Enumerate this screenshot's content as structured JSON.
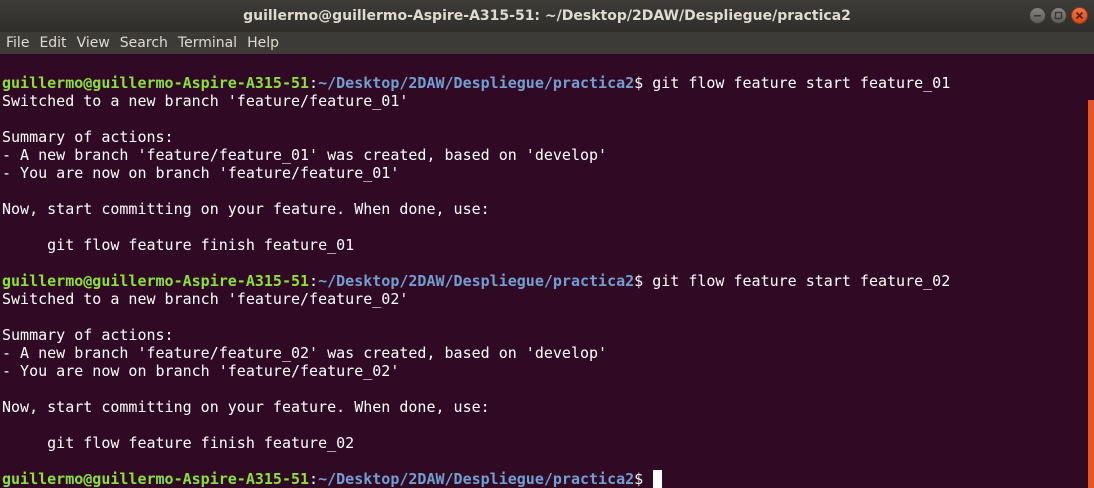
{
  "window": {
    "title": "guillermo@guillermo-Aspire-A315-51: ~/Desktop/2DAW/Despliegue/practica2"
  },
  "menu": {
    "items": [
      "File",
      "Edit",
      "View",
      "Search",
      "Terminal",
      "Help"
    ]
  },
  "colors": {
    "background": "#300a24",
    "prompt_user": "#8ae234",
    "prompt_path": "#729fcf",
    "text": "#ffffff",
    "scrollbar": "#e95420"
  },
  "terminal": {
    "prompts": [
      {
        "user": "guillermo@guillermo-Aspire-A315-51",
        "sep": ":",
        "path": "~/Desktop/2DAW/Despliegue/practica2",
        "symbol": "$ ",
        "command": "git flow feature start feature_01"
      },
      {
        "user": "guillermo@guillermo-Aspire-A315-51",
        "sep": ":",
        "path": "~/Desktop/2DAW/Despliegue/practica2",
        "symbol": "$ ",
        "command": "git flow feature start feature_02"
      },
      {
        "user": "guillermo@guillermo-Aspire-A315-51",
        "sep": ":",
        "path": "~/Desktop/2DAW/Despliegue/practica2",
        "symbol": "$ ",
        "command": ""
      }
    ],
    "outputs": [
      [
        "Switched to a new branch 'feature/feature_01'",
        "",
        "Summary of actions:",
        "- A new branch 'feature/feature_01' was created, based on 'develop'",
        "- You are now on branch 'feature/feature_01'",
        "",
        "Now, start committing on your feature. When done, use:",
        "",
        "     git flow feature finish feature_01",
        ""
      ],
      [
        "Switched to a new branch 'feature/feature_02'",
        "",
        "Summary of actions:",
        "- A new branch 'feature/feature_02' was created, based on 'develop'",
        "- You are now on branch 'feature/feature_02'",
        "",
        "Now, start committing on your feature. When done, use:",
        "",
        "     git flow feature finish feature_02",
        ""
      ]
    ]
  }
}
